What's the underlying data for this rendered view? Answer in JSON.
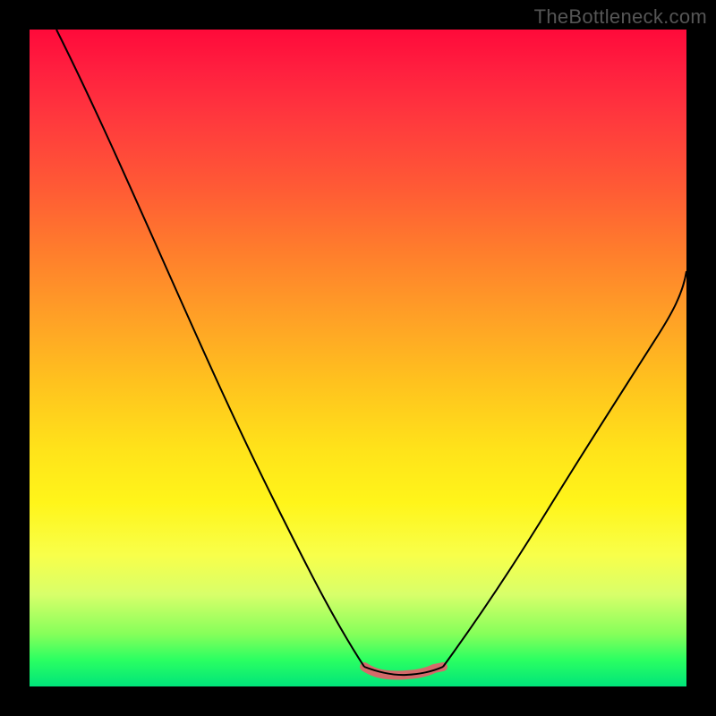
{
  "watermark": {
    "text": "TheBottleneck.com"
  },
  "colors": {
    "frame": "#000000",
    "curve": "#000000",
    "highlight": "#d46a6a",
    "gradient_stops": [
      "#ff0a3a",
      "#ff1f3f",
      "#ff3a3d",
      "#ff5a35",
      "#ff7e2c",
      "#ffa126",
      "#ffc31e",
      "#ffe31a",
      "#fff51a",
      "#f8ff4a",
      "#d8ff6a",
      "#86ff5a",
      "#2aff62",
      "#00e47a"
    ]
  },
  "chart_data": {
    "type": "line",
    "title": "",
    "xlabel": "",
    "ylabel": "",
    "xlim": [
      0,
      100
    ],
    "ylim": [
      0,
      100
    ],
    "grid": false,
    "legend": false,
    "series": [
      {
        "name": "left-branch",
        "x": [
          4,
          8,
          12,
          16,
          20,
          24,
          28,
          32,
          36,
          40,
          44,
          48,
          51
        ],
        "y": [
          100,
          91,
          82,
          73,
          64,
          55,
          46,
          37,
          28,
          20,
          13,
          7,
          3
        ]
      },
      {
        "name": "valley-floor",
        "x": [
          51,
          53,
          55,
          57,
          59,
          61,
          63
        ],
        "y": [
          3,
          2.2,
          1.9,
          1.8,
          1.9,
          2.2,
          3
        ]
      },
      {
        "name": "right-branch",
        "x": [
          63,
          67,
          71,
          75,
          79,
          83,
          87,
          91,
          95,
          100
        ],
        "y": [
          3,
          8,
          14,
          21,
          28,
          35,
          42,
          49,
          56,
          63
        ]
      }
    ],
    "annotations": [
      {
        "name": "valley-highlight",
        "x": [
          51,
          53,
          55,
          57,
          59,
          61,
          63
        ],
        "y": [
          3,
          2.2,
          1.9,
          1.8,
          1.9,
          2.2,
          3
        ],
        "stroke": "#d46a6a",
        "stroke_width": 7
      }
    ]
  }
}
